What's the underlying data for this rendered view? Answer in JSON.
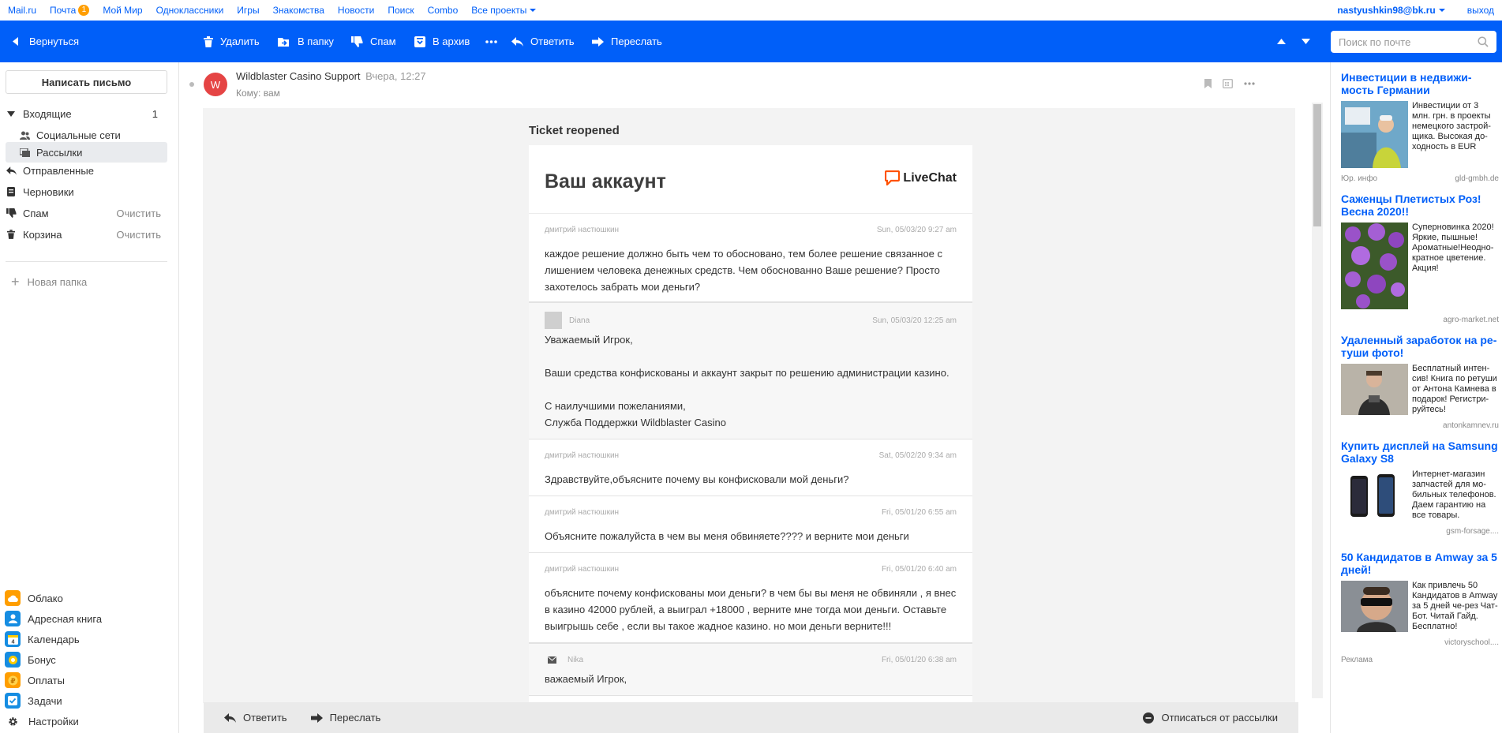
{
  "portal": {
    "links": [
      "Mail.ru",
      "Почта",
      "Мой Мир",
      "Одноклассники",
      "Игры",
      "Знакомства",
      "Новости",
      "Поиск",
      "Combo",
      "Все проекты"
    ],
    "mail_badge": "1",
    "user_email": "nastyushkin98@bk.ru",
    "logout": "выход"
  },
  "toolbar": {
    "back": "Вернуться",
    "delete": "Удалить",
    "to_folder": "В папку",
    "spam": "Спам",
    "archive": "В архив",
    "reply": "Ответить",
    "forward": "Переслать",
    "search_placeholder": "Поиск по почте"
  },
  "sidebar": {
    "compose": "Написать письмо",
    "folders": [
      {
        "label": "Входящие",
        "count": "1"
      },
      {
        "label": "Социальные сети"
      },
      {
        "label": "Рассылки"
      },
      {
        "label": "Отправленные"
      },
      {
        "label": "Черновики"
      },
      {
        "label": "Спам",
        "action": "Очистить"
      },
      {
        "label": "Корзина",
        "action": "Очистить"
      }
    ],
    "new_folder": "Новая папка",
    "apps": [
      {
        "label": "Облако",
        "color": "#ff9e00"
      },
      {
        "label": "Адресная книга",
        "color": "#168de2"
      },
      {
        "label": "Календарь",
        "color": "#168de2"
      },
      {
        "label": "Бонус",
        "color": "#168de2"
      },
      {
        "label": "Оплаты",
        "color": "#ff9e00"
      },
      {
        "label": "Задачи",
        "color": "#168de2"
      }
    ],
    "settings": "Настройки"
  },
  "message": {
    "avatar_letter": "W",
    "sender": "Wildblaster Casino Support",
    "date": "Вчера, 12:27",
    "to": "Кому: вам",
    "ticket_title": "Ticket reopened",
    "card_title": "Ваш аккаунт",
    "logo_text": "LiveChat",
    "entries": [
      {
        "author": "дмитрий настюшкин",
        "when": "Sun, 05/03/20 9:27 am",
        "lines": [
          "каждое решение должно быть чем то обосновано, тем более решение связанное с лишением человека денежных средств. Чем обоснованно Ваше решение? Просто захотелось забрать мои деньги?"
        ]
      },
      {
        "author": "Diana",
        "when": "Sun, 05/03/20 12:25 am",
        "lines": [
          "Уважаемый Игрок,",
          "Ваши средства конфискованы и аккаунт закрыт по решению администрации казино.",
          "С наилучшими пожеланиями,",
          "Служба Поддержки Wildblaster Casino"
        ]
      },
      {
        "author": "дмитрий настюшкин",
        "when": "Sat, 05/02/20 9:34 am",
        "lines": [
          "Здравствуйте,объясните почему вы конфисковали мой деньги?"
        ]
      },
      {
        "author": "дмитрий настюшкин",
        "when": "Fri, 05/01/20 6:55 am",
        "lines": [
          "Объясните пожалуйста в чем вы меня обвиняете???? и верните мои деньги"
        ]
      },
      {
        "author": "дмитрий настюшкин",
        "when": "Fri, 05/01/20 6:40 am",
        "lines": [
          "объясните почему конфискованы мои деньги? в чем бы вы меня не обвиняли , я внес в казино 42000 рублей, а выиграл +18000 , верните мне тогда мои деньги. Оставьте выигрышь себе , если вы такое жадное казино. но мои деньги верните!!!"
        ]
      },
      {
        "author": "Nika",
        "when": "Fri, 05/01/20 6:38 am",
        "lines": [
          "важаемый Игрок,"
        ]
      }
    ]
  },
  "bottom_bar": {
    "reply": "Ответить",
    "forward": "Переслать",
    "unsubscribe": "Отписаться от рассылки"
  },
  "ads": {
    "items": [
      {
        "title": "Инвестиции в недвижи-мость Германии",
        "text": "Инвестиции от 3 млн. грн. в проекты немецкого застрой-щика. Высокая до-ходность в EUR",
        "source": "Юр. инфо",
        "domain": "gld-gmbh.de"
      },
      {
        "title": "Саженцы Плетистых Роз! Весна 2020!!",
        "text": "Суперновинка 2020! Яркие, пышные! Ароматные!Неодно-кратное цветение. Акция!",
        "source": "",
        "domain": "agro-market.net"
      },
      {
        "title": "Удаленный заработок на ре-туши фото!",
        "text": "Бесплатный интен-сив! Книга по ретуши от Антона Камнева в подарок! Регистри-руйтесь!",
        "source": "",
        "domain": "antonkamnev.ru"
      },
      {
        "title": "Купить дисплей на Samsung Galaxy S8",
        "text": "Интернет-магазин запчастей для мо-бильных телефонов. Даем гарантию на все товары.",
        "source": "",
        "domain": "gsm-forsage...."
      },
      {
        "title": "50 Кандидатов в Amway за 5 дней!",
        "text": "Как привлечь 50 Кандидатов в Amway за 5 дней че-рез Чат-Бот. Читай Гайд. Бесплатно!",
        "source": "",
        "domain": "victoryschool...."
      }
    ],
    "label": "Реклама"
  }
}
